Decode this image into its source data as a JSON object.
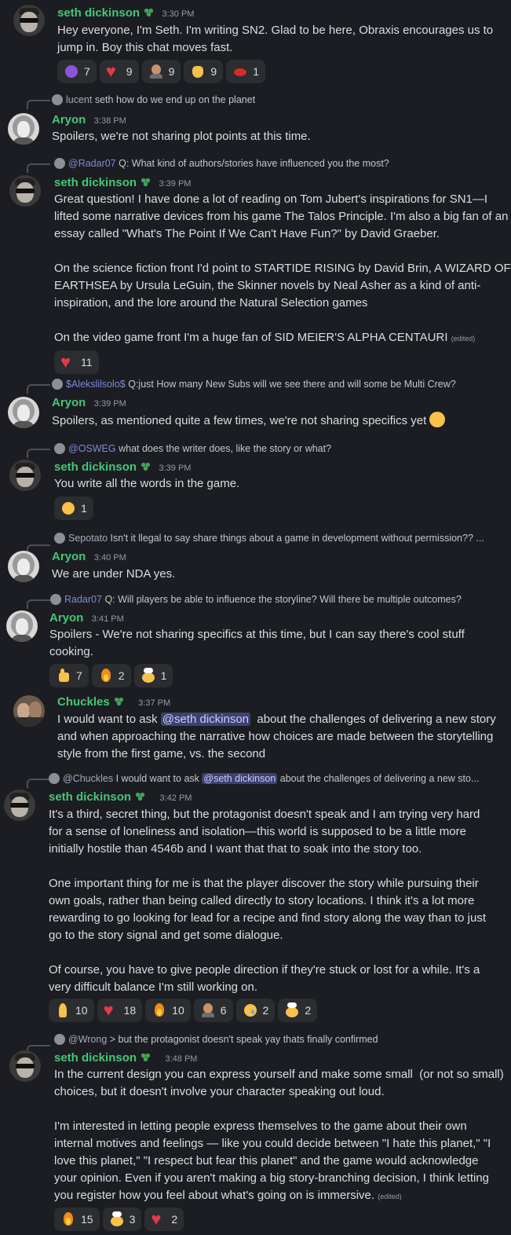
{
  "messages": [
    {
      "author": "seth dickinson",
      "time": "3:30 PM",
      "text": "Hey everyone, I'm Seth. I'm writing SN2. Glad to be here, Obraxis encourages us to\njump in. Boy this chat moves fast.",
      "reactions": [
        {
          "icon": "devil-face-emoji",
          "count": "7"
        },
        {
          "icon": "heart-emoji",
          "count": "9"
        },
        {
          "icon": "old-man-emoji",
          "count": "9"
        },
        {
          "icon": "waving-hand-emoji",
          "count": "9"
        },
        {
          "icon": "crab-emoji",
          "count": "1"
        }
      ]
    },
    {
      "reply": {
        "name": "lucent",
        "text": "seth how do we end up on the planet"
      },
      "author": "Aryon",
      "time": "3:38 PM",
      "text": "Spoilers, we're not sharing plot points at this time."
    },
    {
      "reply": {
        "name": "@Radar07",
        "text": "Q: What kind of authors/stories have influenced you the most?"
      },
      "author": "seth dickinson",
      "time": "3:39 PM",
      "text": "Great question! I have done a lot of reading on Tom Jubert's inspirations for SN1—I\nlifted some narrative devices from his game The Talos Principle. I'm also a big fan of an\nessay called \"What's The Point If We Can't Have Fun?\" by David Graeber.\n\nOn the science fiction front I'd point to STARTIDE RISING by David Brin, A WIZARD OF\nEARTHSEA by Ursula LeGuin, the Skinner novels by Neal Asher as a kind of anti-\ninspiration, and the lore around the Natural Selection games\n\nOn the video game front I'm a huge fan of SID MEIER'S ALPHA CENTAURI",
      "edited": "(edited)",
      "reactions": [
        {
          "icon": "heart-emoji",
          "count": "11"
        }
      ]
    },
    {
      "reply": {
        "name": "$Alekslilsolo$",
        "text": "Q:just How many New Subs will we see there and will some be Multi Crew?"
      },
      "author": "Aryon",
      "time": "3:39 PM",
      "text": "Spoilers, as mentioned quite a few times, we're not sharing specifics yet"
    },
    {
      "reply": {
        "name": "@OSWEG",
        "text": "what does the writer does, like the story or what?"
      },
      "author": "seth dickinson",
      "time": "3:39 PM",
      "text": "You write all the words in the game.",
      "reactions": [
        {
          "icon": "laughing-face-emoji",
          "count": "1"
        }
      ]
    },
    {
      "reply": {
        "name": "Sepotato",
        "text": "Isn't it llegal to say share things about a game in development without permission?? ..."
      },
      "author": "Aryon",
      "time": "3:40 PM",
      "text": "We are under NDA yes."
    },
    {
      "reply": {
        "name": "Radar07",
        "text": "Q: Will players be able to influence the storyline? Will there be multiple outcomes?"
      },
      "author": "Aryon",
      "time": "3:41 PM",
      "text": "Spoilers - We're not sharing specifics at this time, but I can say there's cool stuff\ncooking.",
      "reactions": [
        {
          "icon": "thumbs-up-emoji",
          "count": "7"
        },
        {
          "icon": "fire-emoji",
          "count": "2"
        },
        {
          "icon": "chef-emoji",
          "count": "1"
        }
      ]
    },
    {
      "author": "Chuckles",
      "time": "3:37 PM",
      "text_before": "I would want to ask ",
      "mention": "@seth dickinson",
      "text_after": "  about the challenges of delivering a new story\nand when approaching the narrative how choices are made between the storytelling\nstyle from the first game, vs. the second"
    },
    {
      "reply": {
        "name": "@Chuckles",
        "text_before": "I would want to ask ",
        "mention": "@seth dickinson",
        "text_after": "  about the challenges of delivering a new sto..."
      },
      "author": "seth dickinson",
      "time": "3:42 PM",
      "text": "It's a third, secret thing, but the protagonist doesn't speak and I am trying very hard\nfor a sense of loneliness and isolation—this world is supposed to be a little more\ninitially hostile than 4546b and I want that that to soak into the story too.\n\nOne important thing for me is that the player discover the story while pursuing their\nown goals, rather than being called directly to story locations. I think it's a lot more\nrewarding to go looking for lead for a recipe and find story along the way than to just\ngo to the story signal and get some dialogue.\n\nOf course, you have to give people direction if they're stuck or lost for a while. It's a\nvery difficult balance I'm still working on.",
      "reactions": [
        {
          "icon": "praying-hands-emoji",
          "count": "10"
        },
        {
          "icon": "heart-emoji",
          "count": "18"
        },
        {
          "icon": "fire-emoji",
          "count": "10"
        },
        {
          "icon": "man-face-emoji",
          "count": "6"
        },
        {
          "icon": "crying-face-emoji",
          "count": "2"
        },
        {
          "icon": "chef-emoji",
          "count": "2"
        }
      ]
    },
    {
      "reply": {
        "name": "@Wrong",
        "text": ">  but the protagonist doesn't speak yay thats finally confirmed"
      },
      "author": "seth dickinson",
      "time": "3:48 PM",
      "text": "In the current design you can express yourself and make some small  (or not so small)\nchoices, but it doesn't involve your character speaking out loud.\n\nI'm interested in letting people express themselves to the game about their own\ninternal motives and feelings — like you could decide between \"I hate this planet,\" \"I\nlove this planet,\" \"I respect but fear this planet\" and the game would acknowledge\nyour opinion. Even if you aren't making a big story-branching decision, I think letting\nyou register how you feel about what's going on is immersive.",
      "edited": "(edited)",
      "reactions": [
        {
          "icon": "fire-emoji",
          "count": "15"
        },
        {
          "icon": "chef-emoji",
          "count": "3"
        },
        {
          "icon": "heart-emoji",
          "count": "2"
        }
      ]
    }
  ]
}
